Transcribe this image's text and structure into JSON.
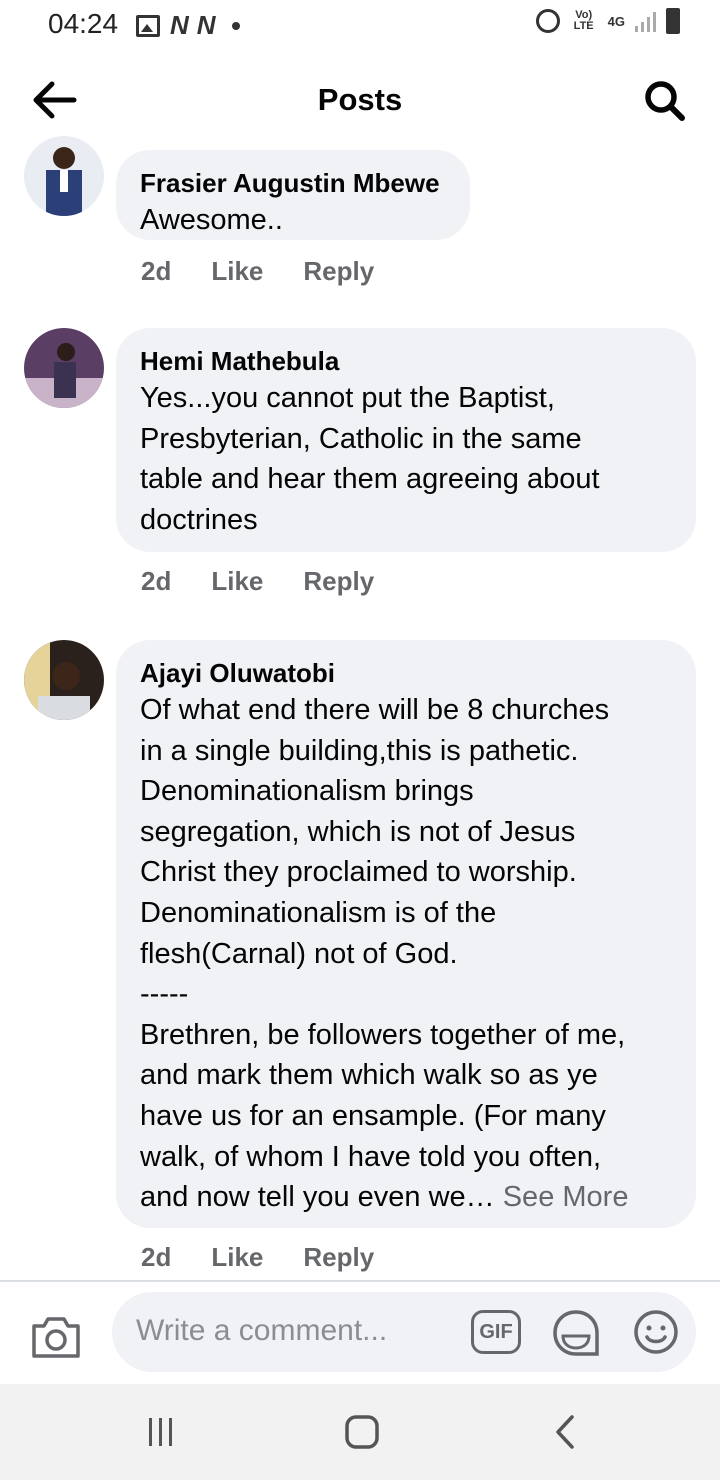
{
  "status_bar": {
    "time": "04:24",
    "left_icons": [
      "image-icon",
      "notification-n-icon",
      "notification-n-icon"
    ],
    "volte": "Vo) LTE",
    "network": "4G",
    "right_icons": [
      "alarm-icon",
      "volte-icon",
      "4g-icon",
      "signal-icon",
      "battery-icon"
    ]
  },
  "header": {
    "title": "Posts",
    "back_icon": "back-arrow-icon",
    "search_icon": "search-icon"
  },
  "comments": [
    {
      "author": "Frasier Augustin Mbewe",
      "text": "Awesome..",
      "time": "2d",
      "like": "Like",
      "reply": "Reply"
    },
    {
      "author": "Hemi Mathebula",
      "text": "Yes...you cannot put the Baptist,\nPresbyterian, Catholic in the same\ntable and hear them agreeing about\ndoctrines",
      "time": "2d",
      "like": "Like",
      "reply": "Reply"
    },
    {
      "author": "Ajayi Oluwatobi",
      "text": "Of what end there will be 8 churches\nin a single building,this is pathetic.\nDenominationalism brings\nsegregation, which is not of Jesus\nChrist they proclaimed to worship.\nDenominationalism is of the\nflesh(Carnal) not of God.\n-----\nBrethren, be followers together of me,\nand mark them which walk so as ye\nhave us for an ensample. (For many\nwalk, of whom I have told you often,\nand now tell you even we…",
      "see_more": "See More",
      "time": "2d",
      "like": "Like",
      "reply": "Reply"
    }
  ],
  "composer": {
    "placeholder": "Write a comment...",
    "gif_label": "GIF",
    "icons": [
      "camera-icon",
      "gif-icon",
      "sticker-icon",
      "emoji-icon"
    ]
  },
  "navbar": {
    "icons": [
      "recent-apps-icon",
      "home-icon",
      "back-icon"
    ]
  },
  "colors": {
    "bubble": "#f0f2f5",
    "meta_text": "#65676b",
    "text": "#050505"
  }
}
